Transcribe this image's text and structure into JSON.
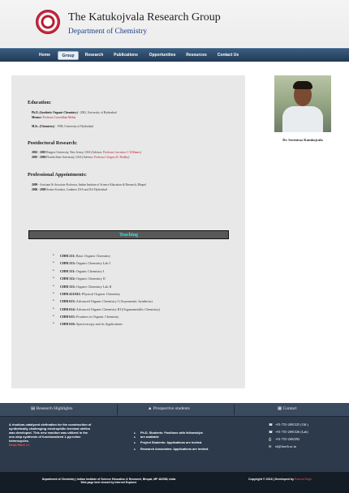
{
  "header": {
    "title": "The Katukojvala Research Group",
    "subtitle": "Department of Chemistry"
  },
  "nav": {
    "items": [
      "Home",
      "Group",
      "Research",
      "Publications",
      "Opportunities",
      "Resources",
      "Contact Us"
    ],
    "active": "Group"
  },
  "profile": {
    "caption": "Dr. Sreenivas Katukojvala"
  },
  "education": {
    "title": "Education:",
    "phd": {
      "degree": "Ph.D. (Synthetic Organic Chemistry)",
      "detail": " - 2002, University of Hyderabad",
      "mentor_label": "Mentor:",
      "mentor": " Professor Goverdhan Mehta"
    },
    "msc": {
      "degree": "M.Sc. (Chemistry)",
      "detail": " - 1996, University of Hyderabad"
    }
  },
  "postdoc": {
    "title": "Postdoctoral Research:",
    "lines": [
      {
        "years": "2002 - 2005",
        "text": " Rutgers University, New Jersey, USA (Advisor: ",
        "advisor": "Professor Lawrence J. Williams",
        "end": ")"
      },
      {
        "years": "2005 - 2006",
        "text": " Florida State University, USA (Advisor: ",
        "advisor": "Professor Gregory B. Dudley",
        "end": ")"
      }
    ]
  },
  "appointments": {
    "title": "Professional Appointments:",
    "lines": [
      {
        "years": "2009 -",
        "text": " Assistant & Associate Professor, Indian Institute of Science Education & Research, Bhopal"
      },
      {
        "years": "2006 - 2009",
        "text": " Senior Scientist, Cambrex USA and ILS Hyderabad"
      }
    ]
  },
  "teaching": {
    "title": "Teaching",
    "courses": [
      {
        "code": "CHM 211:",
        "name": " Basic Organic Chemistry"
      },
      {
        "code": "CHM 213:",
        "name": " Organic Chemistry Lab I"
      },
      {
        "code": "CHM 311:",
        "name": " Organic Chemistry I"
      },
      {
        "code": "CHM 312:",
        "name": " Organic Chemistry II"
      },
      {
        "code": "CHM 313:",
        "name": " Organic Chemistry Lab II"
      },
      {
        "code": "CHM 411/611:",
        "name": " Physical Organic Chemistry"
      },
      {
        "code": "CHM 613:",
        "name": " Advanced Organic Chemistry I (Asymmetric Synthesis)"
      },
      {
        "code": "CHM 614:",
        "name": " Advanced Organic Chemistry III (Organometallic Chemistry)"
      },
      {
        "code": "CHM 615:",
        "name": " Frontiers in Organic Chemistry"
      },
      {
        "code": "CHM 616:",
        "name": " Spectroscopy and its Applications"
      }
    ]
  },
  "footer": {
    "heads": [
      "Research Highlights",
      "Prospective students",
      "Contact"
    ],
    "highlight": {
      "lines": [
        "A rhodium-catalyzed olefination for the construction of",
        "synthetically challenging electrophilic terminal olefins",
        "was developed. This new reaction was utilized in the",
        "one-step synthesis of functionalized 1-pyrroline",
        "heterocycles."
      ],
      "link": "Read More >>"
    },
    "students": [
      {
        "text": "Ph.D. Students: Positions with ",
        "ital": "fellowships",
        "line2": "are available"
      },
      {
        "text": "Project Students: Applications are invited."
      },
      {
        "text": "Research Associates: Applications are invited."
      }
    ],
    "contact": [
      {
        "icon": "phone-icon",
        "text": "+91-755-2691325 (Off.)"
      },
      {
        "icon": "phone-icon",
        "text": "+91-755-2691326 (Lab)"
      },
      {
        "icon": "printer-icon",
        "text": "+91-755-2692392"
      },
      {
        "icon": "mail-icon",
        "text": "sk@iiserb.ac.in"
      }
    ],
    "copyright_left": "Department of Chemistry | Indian Institute of Science Education & Research, Bhopal, MP 462066, India",
    "copyright_left2": "Web page best viewed by Internet Explorer",
    "copyright_right": "Copyright © 2018 | Developed by ",
    "developer": "Kamran Singh"
  }
}
